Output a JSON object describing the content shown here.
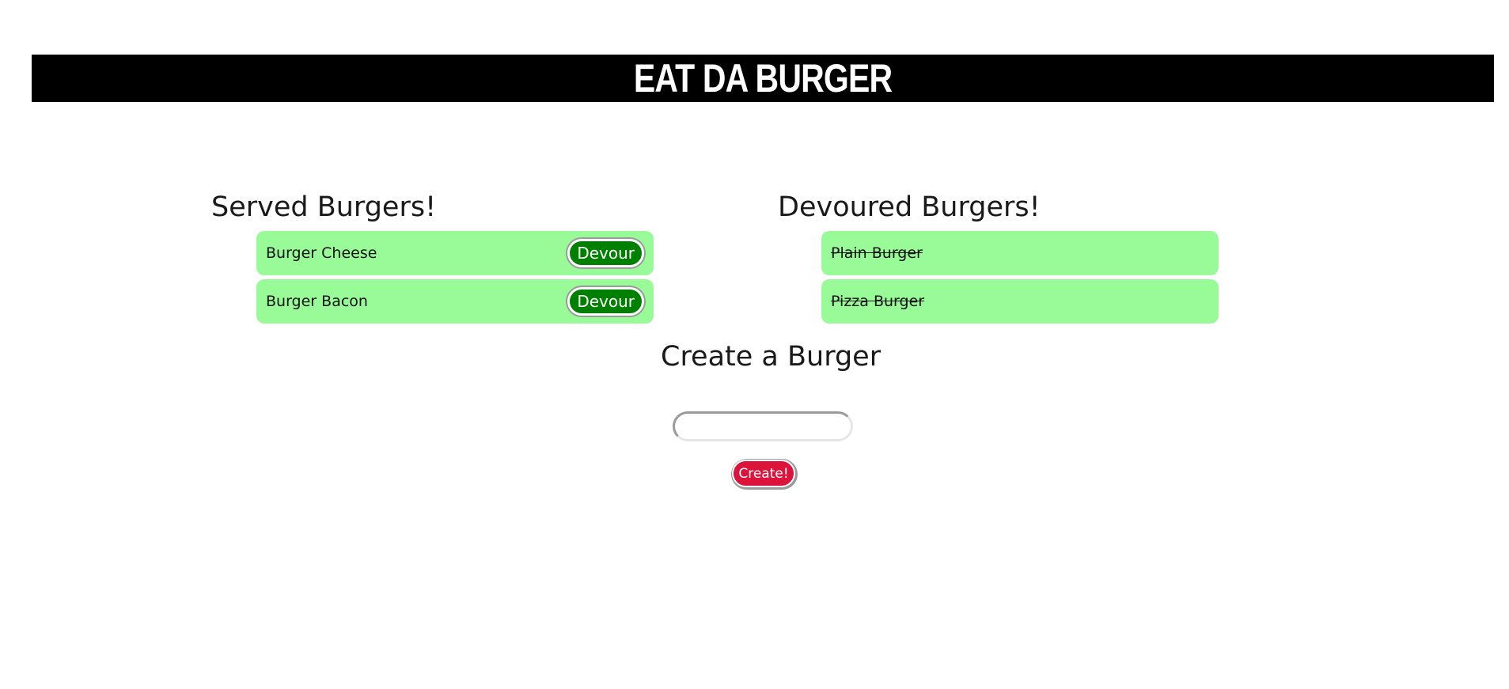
{
  "header": {
    "title": "EAT DA BURGER"
  },
  "served": {
    "heading": "Served Burgers!",
    "items": [
      {
        "name": "Burger Cheese",
        "button_label": "Devour"
      },
      {
        "name": "Burger Bacon",
        "button_label": "Devour"
      }
    ]
  },
  "devoured": {
    "heading": "Devoured Burgers!",
    "items": [
      {
        "name": "Plain Burger"
      },
      {
        "name": "Pizza Burger"
      }
    ]
  },
  "create": {
    "heading": "Create a Burger",
    "input_value": "",
    "button_label": "Create!"
  },
  "colors": {
    "banner": "#000000",
    "item_bg": "#98fb98",
    "devour_button": "#008000",
    "create_button": "#dc143c"
  }
}
